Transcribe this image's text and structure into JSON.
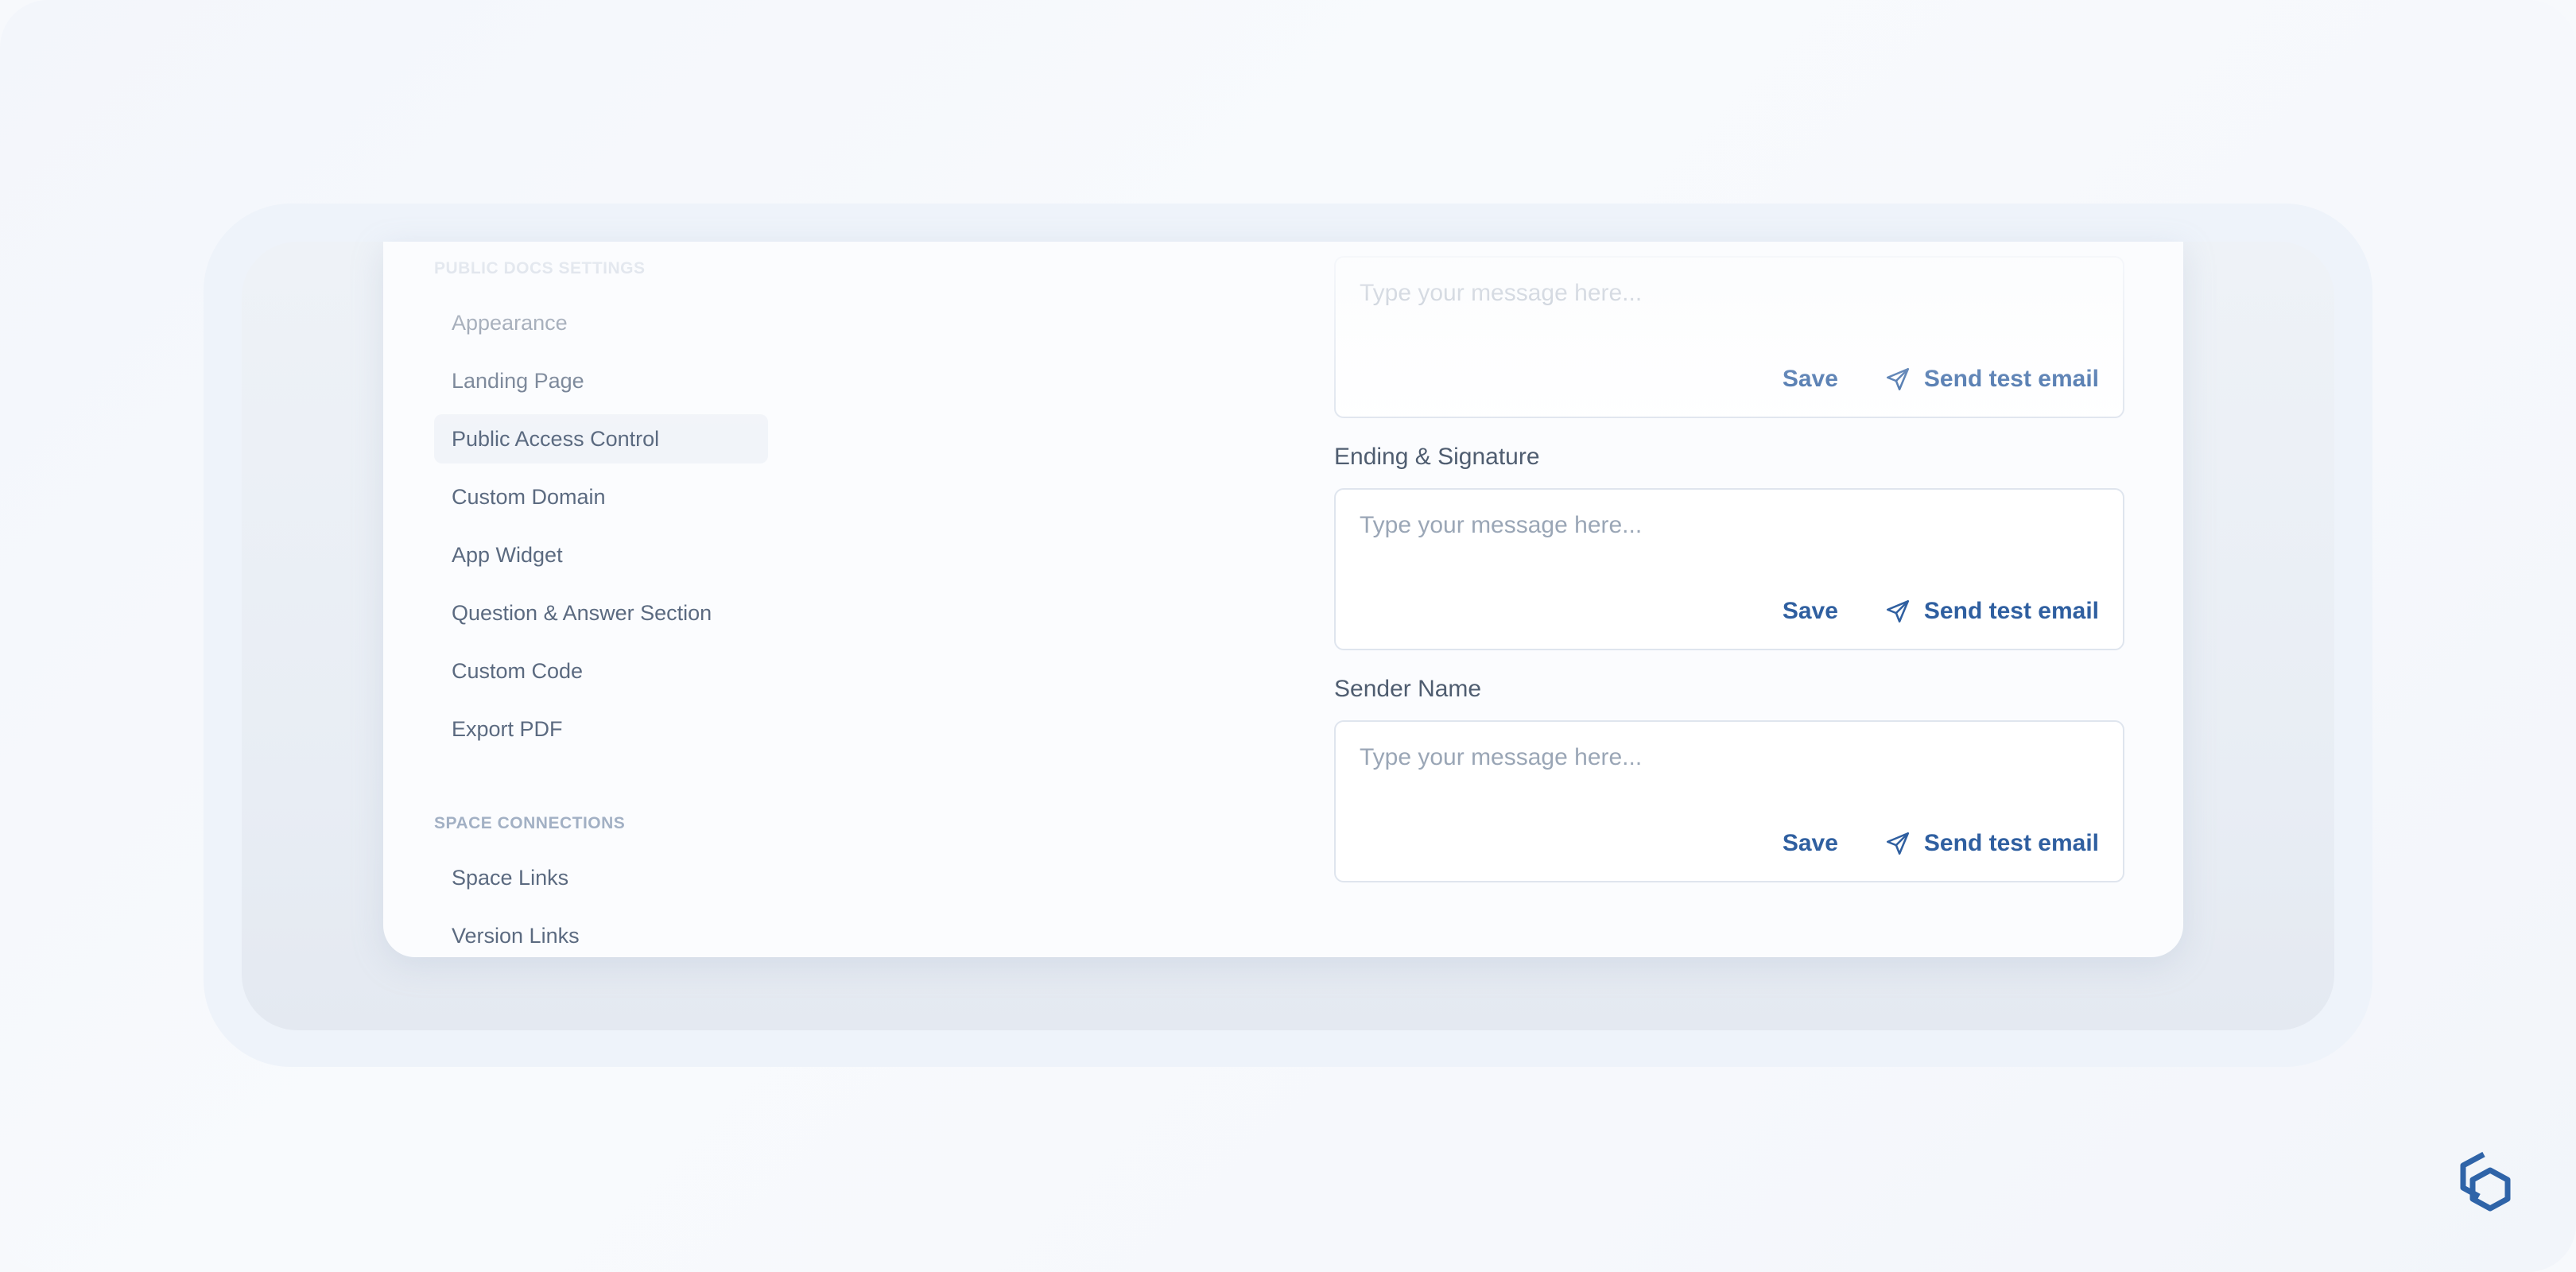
{
  "sidebar": {
    "sections": [
      {
        "title": "PUBLIC DOCS SETTINGS",
        "items": [
          {
            "label": "Appearance"
          },
          {
            "label": "Landing Page"
          },
          {
            "label": "Public Access Control",
            "active": true
          },
          {
            "label": "Custom Domain"
          },
          {
            "label": "App Widget"
          },
          {
            "label": "Question & Answer Section"
          },
          {
            "label": "Custom Code"
          },
          {
            "label": "Export PDF"
          }
        ]
      },
      {
        "title": "SPACE CONNECTIONS",
        "items": [
          {
            "label": "Space Links"
          },
          {
            "label": "Version Links"
          }
        ]
      }
    ]
  },
  "form": {
    "fields": [
      {
        "label": "",
        "placeholder": "Type your message here...",
        "save_label": "Save",
        "send_label": "Send test email"
      },
      {
        "label": "Ending & Signature",
        "placeholder": "Type your message here...",
        "save_label": "Save",
        "send_label": "Send test email"
      },
      {
        "label": "Sender Name",
        "placeholder": "Type your message here...",
        "save_label": "Save",
        "send_label": "Send test email"
      }
    ]
  },
  "colors": {
    "accent": "#2f5fa0",
    "muted_text": "#5b6a80",
    "section_title": "#a2b0c4"
  },
  "icons": {
    "send": "send-icon",
    "logo": "brand-logo-icon"
  }
}
